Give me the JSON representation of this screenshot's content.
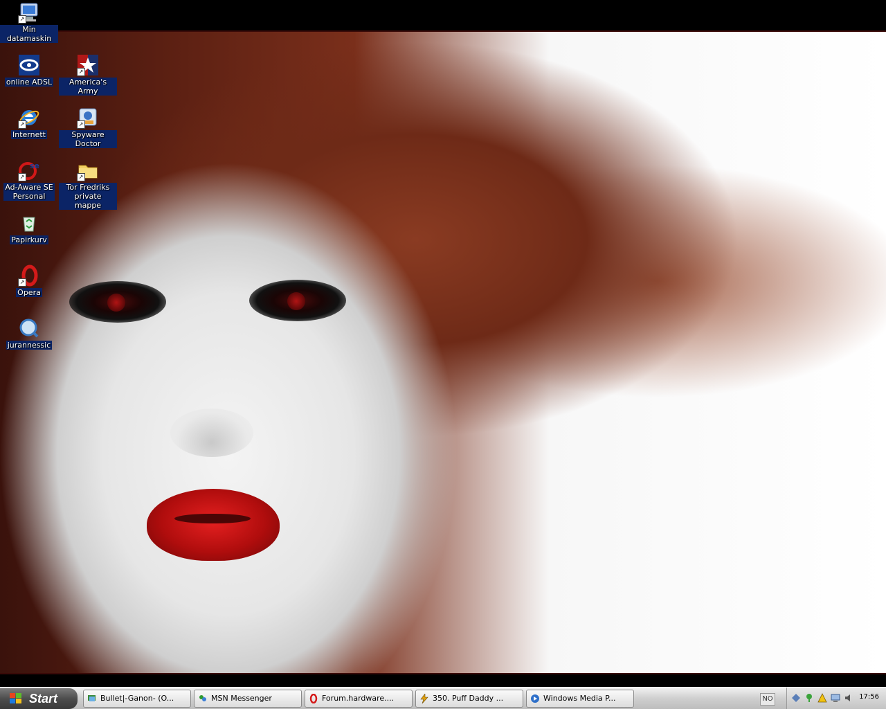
{
  "desktop": {
    "icons": [
      {
        "label": "Min datamaskin",
        "icon": "my-computer-icon"
      },
      {
        "label": "online ADSL",
        "icon": "online-adsl-icon"
      },
      {
        "label": "America's Army",
        "icon": "americas-army-icon"
      },
      {
        "label": "Internett",
        "icon": "internet-explorer-icon"
      },
      {
        "label": "Spyware Doctor",
        "icon": "spyware-doctor-icon"
      },
      {
        "label": "Ad-Aware SE\nPersonal",
        "icon": "ad-aware-icon"
      },
      {
        "label": "Tor Fredriks\nprivate mappe",
        "icon": "folder-icon"
      },
      {
        "label": "Papirkurv",
        "icon": "recycle-bin-icon"
      },
      {
        "label": "Opera",
        "icon": "opera-icon"
      },
      {
        "label": "jurannessic",
        "icon": "quicktime-icon"
      }
    ]
  },
  "taskbar": {
    "start_label": "Start",
    "tasks": [
      {
        "label": "Bullet|-Ganon- (O...",
        "icon": "msn-chat-icon"
      },
      {
        "label": "MSN Messenger",
        "icon": "msn-messenger-icon"
      },
      {
        "label": "Forum.hardware....",
        "icon": "opera-icon"
      },
      {
        "label": "350. Puff Daddy ...",
        "icon": "winamp-icon"
      },
      {
        "label": "Windows Media P...",
        "icon": "windows-media-player-icon"
      }
    ],
    "language": "NO",
    "clock": "17:56"
  },
  "colors": {
    "taskbar_bg": "#d0d0d0",
    "start_bg": "#4d4d4d",
    "icon_label_selected": "#0b2466"
  }
}
